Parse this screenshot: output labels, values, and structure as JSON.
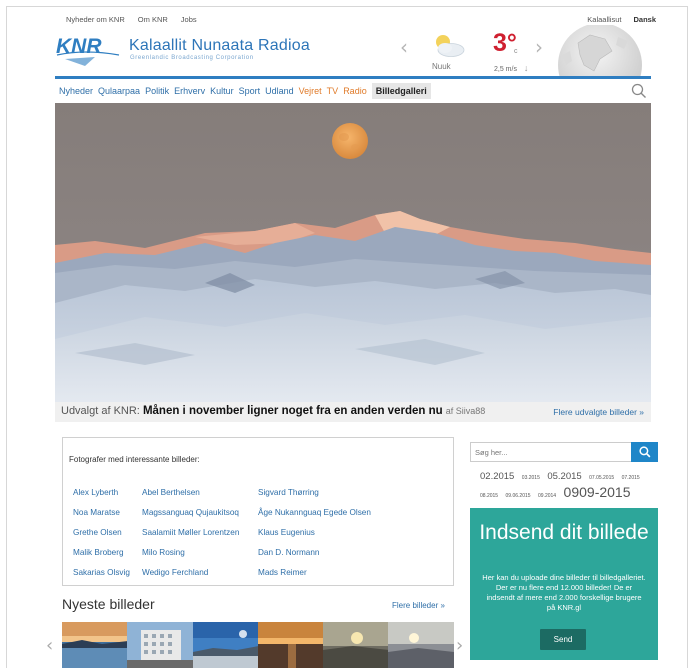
{
  "top_links": {
    "left": [
      "Nyheder om KNR",
      "Om KNR",
      "Jobs"
    ],
    "right": [
      "Kalaallisut",
      "Dansk"
    ]
  },
  "brand": {
    "logo_text": "KNR",
    "name": "Kalaallit Nunaata Radioa",
    "subtitle": "Greenlandic Broadcasting Corporation"
  },
  "weather": {
    "city": "Nuuk",
    "temperature": "3°",
    "unit": "c",
    "wind": "2,5 m/s"
  },
  "nav": {
    "items": [
      {
        "label": "Nyheder",
        "style": "normal"
      },
      {
        "label": "Qulaarpaa",
        "style": "normal"
      },
      {
        "label": "Politik",
        "style": "normal"
      },
      {
        "label": "Erhverv",
        "style": "normal"
      },
      {
        "label": "Kultur",
        "style": "normal"
      },
      {
        "label": "Sport",
        "style": "normal"
      },
      {
        "label": "Udland",
        "style": "normal"
      },
      {
        "label": "Vejret",
        "style": "orange"
      },
      {
        "label": "TV",
        "style": "orange"
      },
      {
        "label": "Radio",
        "style": "orange"
      },
      {
        "label": "Billedgalleri",
        "style": "active"
      }
    ]
  },
  "hero": {
    "prefix": "Udvalgt af KNR:",
    "title": "Månen i november ligner noget fra en anden verden nu",
    "byline": "af Siiva88",
    "more_link": "Flere udvalgte billeder »"
  },
  "photographers": {
    "title": "Fotografer med interessante billeder:",
    "columns": [
      [
        "Alex Lyberth",
        "Noa Maratse",
        "Grethe Olsen",
        "Malik Broberg",
        "Sakarias Olsvig"
      ],
      [
        "Abel Berthelsen",
        "Magssanguaq Qujaukitsoq",
        "Saalamiit Møller Lorentzen",
        "Milo Rosing",
        "Wedigo Ferchland"
      ],
      [
        "Sigvard Thørring",
        "Åge Nukannguaq Egede Olsen",
        "Klaus Eugenius",
        "Dan D. Normann",
        "Mads Reimer"
      ]
    ]
  },
  "search": {
    "placeholder": "Søg her..."
  },
  "archive_dates": [
    {
      "label": "02.2015",
      "size": "big"
    },
    {
      "label": "03.2015",
      "size": "small"
    },
    {
      "label": "05.2015",
      "size": "big"
    },
    {
      "label": "07.05.2015",
      "size": "small"
    },
    {
      "label": "07.2015",
      "size": "small"
    },
    {
      "label": "08.2015",
      "size": "small"
    },
    {
      "label": "09.06.2015",
      "size": "small"
    },
    {
      "label": "09.2014",
      "size": "small"
    },
    {
      "label": "0909-2015",
      "size": "xl"
    }
  ],
  "submit": {
    "title": "Indsend dit billede",
    "text": "Her kan du uploade dine billeder til billedgalleriet. Der er nu flere end 12.000 billeder! De er indsendt af mere end 2.000 forskellige brugere på KNR.gl",
    "button": "Send"
  },
  "newest": {
    "title": "Nyeste billeder",
    "more_link": "Flere billeder »",
    "thumb_count": 6
  },
  "colors": {
    "brand_blue": "#2f7ec1",
    "link_blue": "#2f6fa8",
    "orange": "#e07b2a",
    "temp_red": "#cf2030",
    "teal": "#2da69a"
  }
}
